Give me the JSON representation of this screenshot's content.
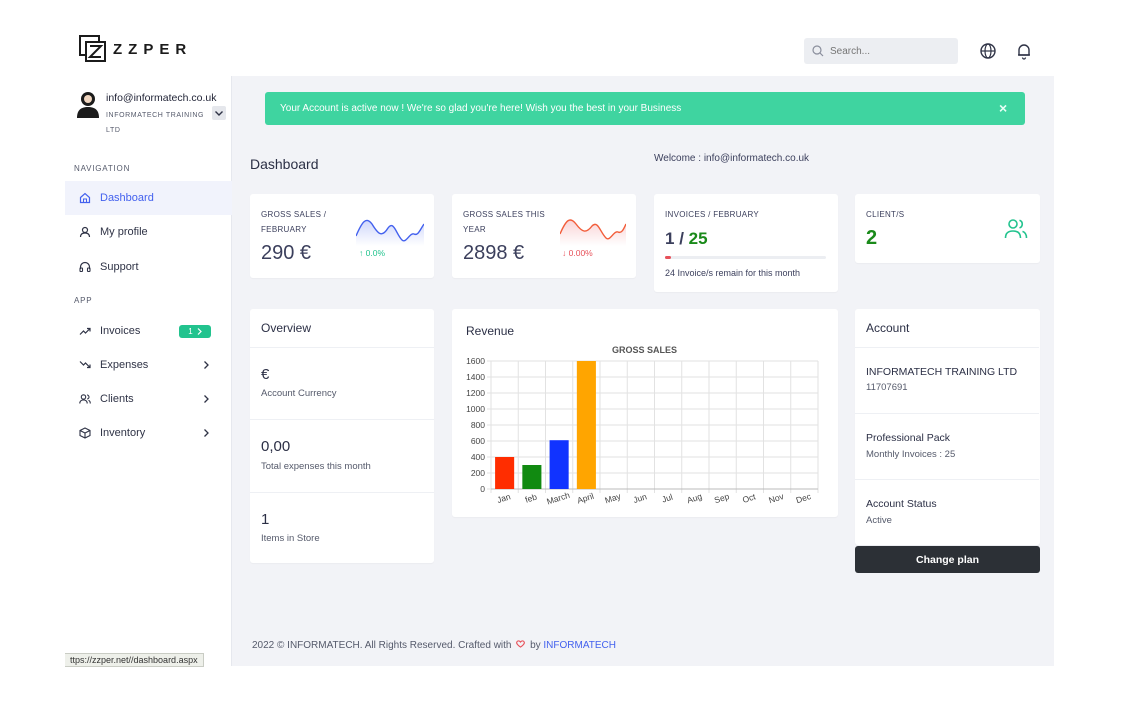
{
  "brand": {
    "logo_text": "ZZPER"
  },
  "header": {
    "search_placeholder": "Search..."
  },
  "user": {
    "email": "info@informatech.co.uk",
    "company": "INFORMATECH TRAINING LTD"
  },
  "sidebar": {
    "navigation_label": "NAVIGATION",
    "app_label": "APP",
    "nav_items": [
      {
        "label": "Dashboard",
        "icon": "home-icon",
        "active": true
      },
      {
        "label": "My profile",
        "icon": "user-icon"
      },
      {
        "label": "Support",
        "icon": "headphones-icon"
      }
    ],
    "app_items": [
      {
        "label": "Invoices",
        "icon": "trending-up-icon",
        "badge": "1"
      },
      {
        "label": "Expenses",
        "icon": "trending-down-icon"
      },
      {
        "label": "Clients",
        "icon": "users-icon"
      },
      {
        "label": "Inventory",
        "icon": "box-icon"
      }
    ]
  },
  "alert": {
    "text": "Your Account is active now ! We're so glad you're here! Wish you the best in your Business",
    "close": "×"
  },
  "page": {
    "title": "Dashboard",
    "welcome": "Welcome : info@informatech.co.uk"
  },
  "kpis": {
    "gross_month": {
      "label": "GROSS SALES / FEBRUARY",
      "value": "290 €",
      "trend": "0.0%",
      "trend_arrow": "↑",
      "trend_color": "#22c38e"
    },
    "gross_year": {
      "label": "GROSS SALES THIS YEAR",
      "value": "2898 €",
      "trend": "0.00%",
      "trend_arrow": "↓",
      "trend_color": "#e7515a"
    },
    "invoices": {
      "label": "INVOICES / FEBRUARY",
      "used": "1",
      "sep": " / ",
      "total": "25",
      "progress": 0.04,
      "remain": "24 Invoice/s remain for this month"
    },
    "clients": {
      "label": "CLIENT/S",
      "value": "2"
    }
  },
  "overview": {
    "title": "Overview",
    "rows": [
      {
        "value": "€",
        "label": "Account Currency"
      },
      {
        "value": "0,00",
        "label": "Total expenses this month"
      },
      {
        "value": "1",
        "label": "Items in Store"
      }
    ]
  },
  "revenue": {
    "title": "Revenue"
  },
  "chart_data": {
    "type": "bar",
    "title": "GROSS SALES",
    "categories": [
      "Jan",
      "feb",
      "March",
      "April",
      "May",
      "Jun",
      "Jul",
      "Aug",
      "Sep",
      "Oct",
      "Nov",
      "Dec"
    ],
    "values": [
      400,
      300,
      610,
      1600,
      0,
      0,
      0,
      0,
      0,
      0,
      0,
      0
    ],
    "colors": [
      "#ff2d00",
      "#118a11",
      "#1133ff",
      "#ffa500"
    ],
    "ylim": [
      0,
      1600
    ],
    "yticks": [
      0,
      200,
      400,
      600,
      800,
      1000,
      1200,
      1400,
      1600
    ],
    "grid": true,
    "xlabel": "",
    "ylabel": ""
  },
  "account": {
    "title": "Account",
    "company": "INFORMATECH TRAINING LTD",
    "number": "11707691",
    "plan": "Professional Pack",
    "plan_detail": "Monthly Invoices : 25",
    "status_label": "Account Status",
    "status": "Active",
    "change_plan": "Change plan"
  },
  "footer": {
    "text": "2022 © INFORMATECH. All Rights Reserved. Crafted with",
    "by": "by",
    "brand": "INFORMATECH"
  },
  "statusbar": {
    "url": "ttps://zzper.net//dashboard.aspx"
  }
}
